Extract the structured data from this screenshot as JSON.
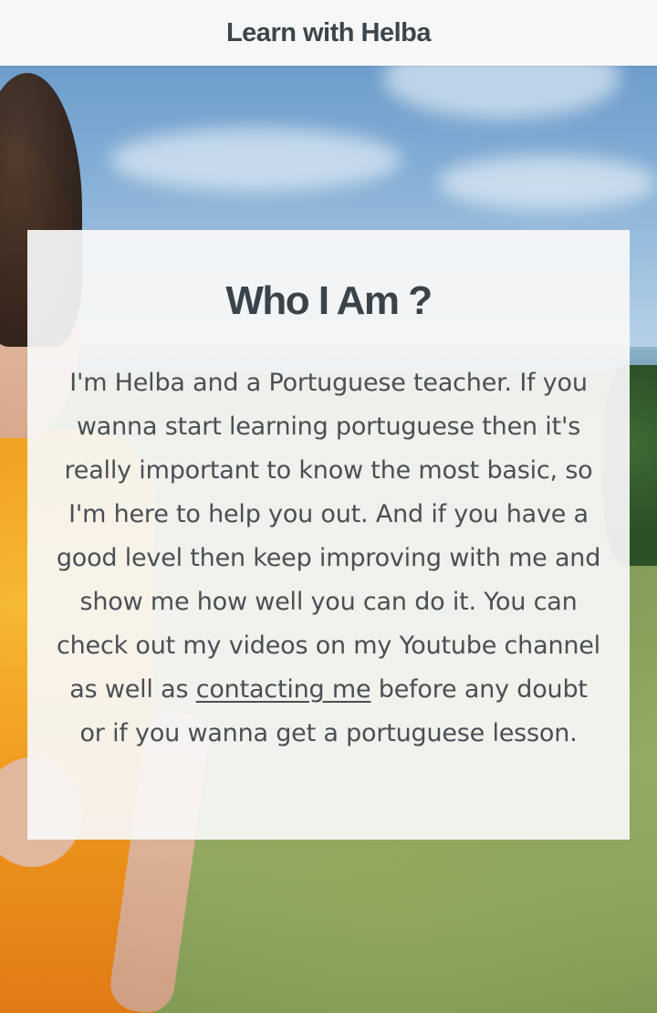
{
  "header": {
    "title": "Learn with Helba"
  },
  "about": {
    "heading": "Who I Am ?",
    "text_before_link": "I'm Helba and a Portuguese teacher. If you wanna start learning portuguese then it's really important to know the most basic, so I'm here to help you out. And if you have a good level then keep improving with me and show me how well you can do it. You can check out my videos on my Youtube channel as well as ",
    "link_label": "contacting me",
    "text_after_link": " before any doubt or if you wanna get a portuguese lesson."
  },
  "colors": {
    "header_bg": "#f7f7f7",
    "title_text": "#3b454b",
    "card_bg": "#f8f8f8",
    "body_text": "#4a4f54"
  }
}
